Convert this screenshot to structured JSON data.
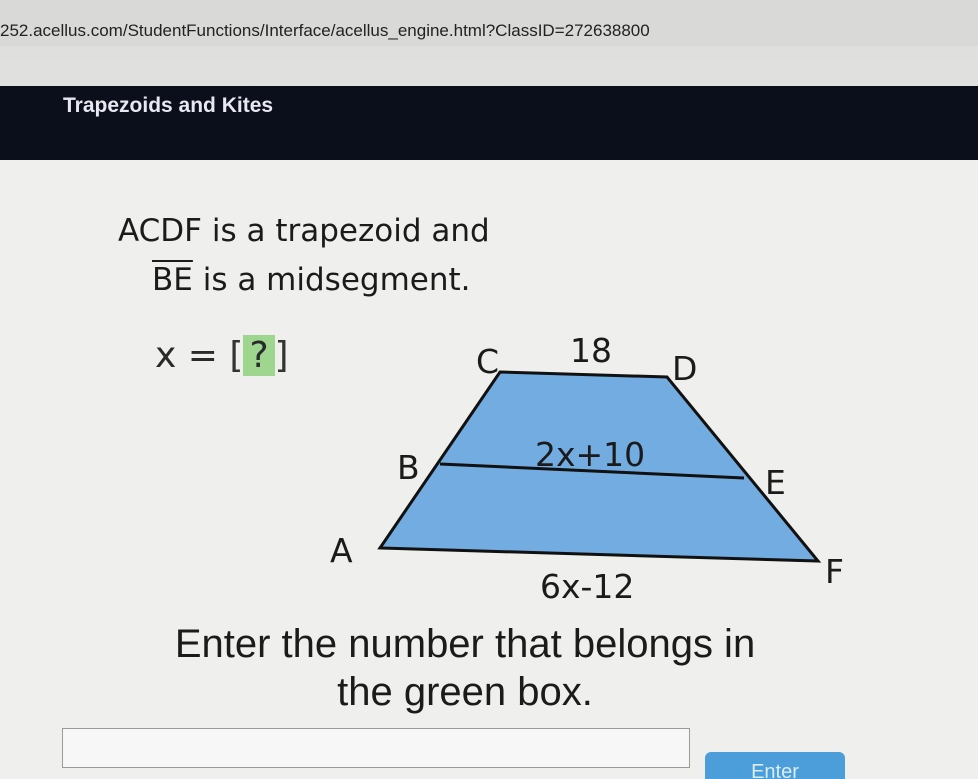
{
  "browser": {
    "url": "252.acellus.com/StudentFunctions/Interface/acellus_engine.html?ClassID=272638800"
  },
  "lesson": {
    "title": "Trapezoids and Kites"
  },
  "problem": {
    "line1": "ACDF is a trapezoid and",
    "line2_segment": "BE",
    "line2_rest": " is a midsegment.",
    "variable": "x",
    "equals": "=",
    "bracket_open": "[",
    "placeholder": "?",
    "bracket_close": "]"
  },
  "figure": {
    "fill_color": "#72ace0",
    "labels": {
      "A": "A",
      "B": "B",
      "C": "C",
      "D": "D",
      "E": "E",
      "F": "F"
    },
    "top_base": "18",
    "midsegment": "2x+10",
    "bottom_base": "6x-12"
  },
  "instructions": {
    "line1": "Enter the number that belongs in",
    "line2": "the green box."
  },
  "answer": {
    "value": "",
    "button_label": "Enter"
  }
}
